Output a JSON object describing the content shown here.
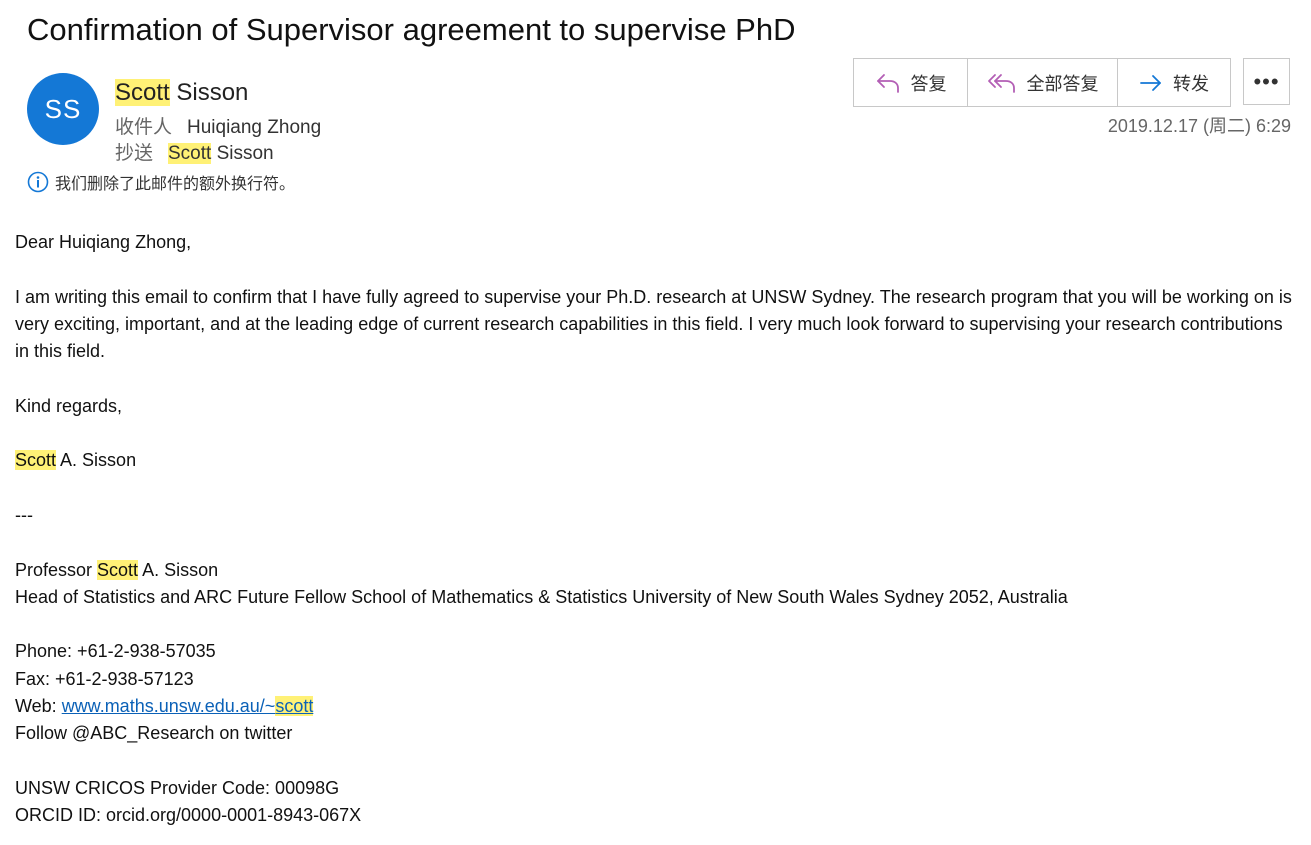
{
  "email": {
    "subject": "Confirmation of Supervisor agreement to supervise PhD",
    "avatar_initials": "SS",
    "sender_first": "Scott",
    "sender_last": " Sisson",
    "to_label": "收件人",
    "to_value": "Huiqiang Zhong",
    "cc_label": "抄送",
    "cc_first": "Scott",
    "cc_last": " Sisson",
    "notice": "我们删除了此邮件的额外换行符。",
    "date": "2019.12.17 (周二) 6:29",
    "highlight_color": "#fff176",
    "accent_color": "#1478d6"
  },
  "toolbar": {
    "reply_label": "答复",
    "reply_all_label": "全部答复",
    "forward_label": "转发",
    "more_label": "•••"
  },
  "body": {
    "greeting": "Dear Huiqiang Zhong,",
    "paragraph": "I am writing this email to confirm that I have fully agreed to supervise your Ph.D. research at UNSW Sydney. The research program that you will be working on is very exciting, important, and at the leading edge of current research capabilities in this field. I very much look forward to supervising your research contributions in this field.",
    "closing": "Kind regards,",
    "signoff_first": "Scott",
    "signoff_rest": " A. Sisson",
    "separator": "---",
    "sig_title_pre": "Professor ",
    "sig_title_name": "Scott",
    "sig_title_post": " A. Sisson",
    "sig_position": "Head of Statistics and ARC Future Fellow School of Mathematics & Statistics University of New South Wales Sydney 2052, Australia",
    "phone": "Phone: +61-2-938-57035",
    "fax": "Fax: +61-2-938-57123",
    "web_label": "Web: ",
    "web_link_main": "www.maths.unsw.edu.au/~",
    "web_link_hl": "scott",
    "twitter": "Follow @ABC_Research on twitter",
    "cricos": "UNSW CRICOS Provider Code: 00098G",
    "orcid": "ORCID ID: orcid.org/0000-0001-8943-067X"
  }
}
